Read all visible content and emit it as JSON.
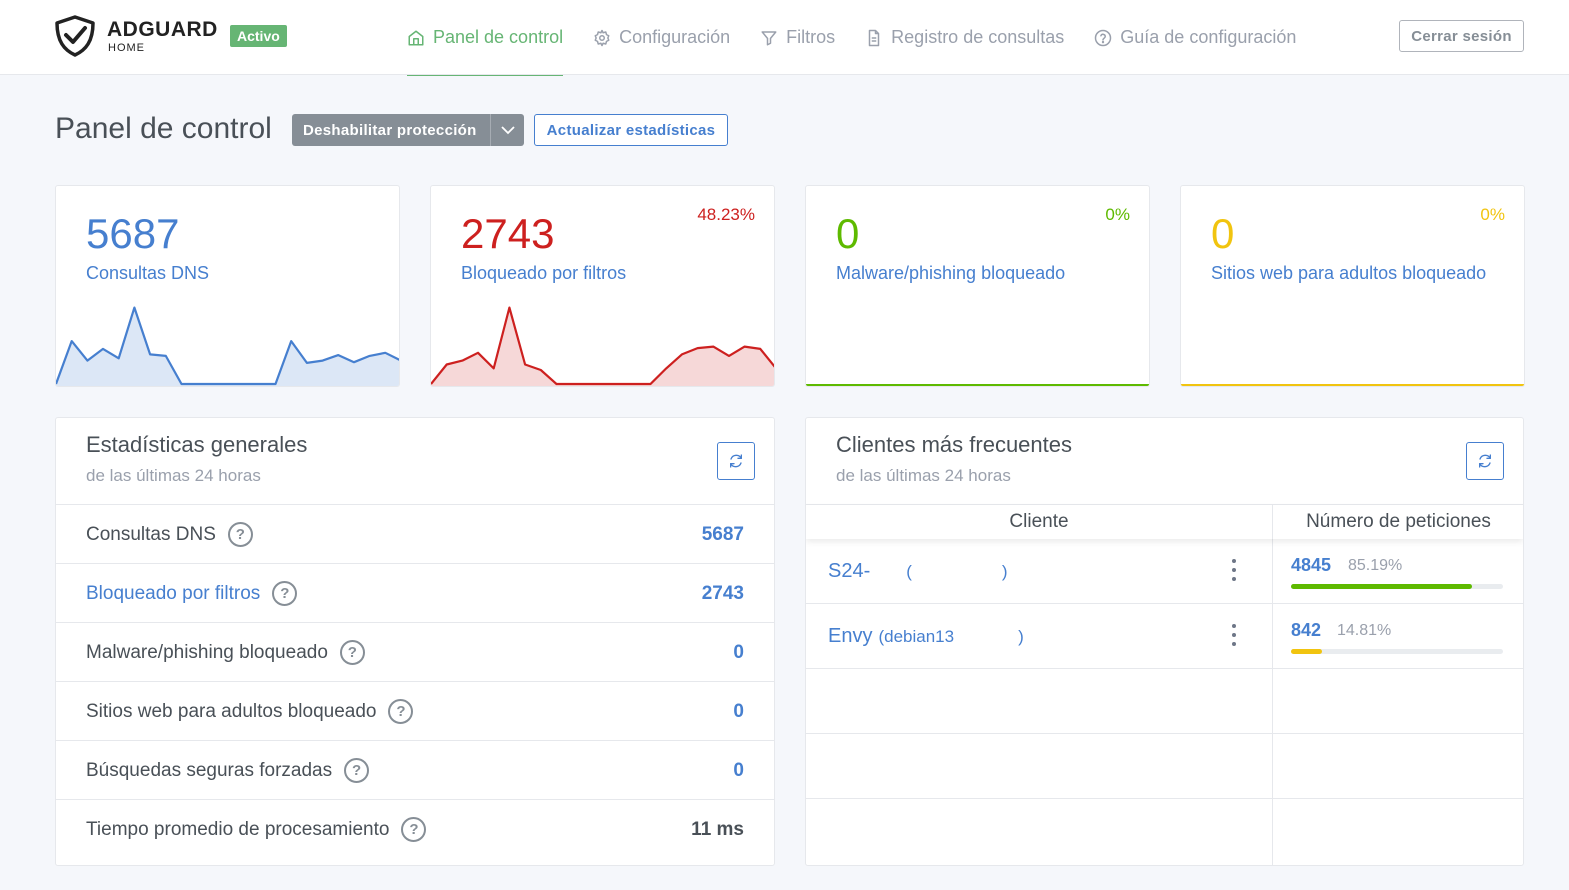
{
  "header": {
    "brand": "ADGUARD",
    "brand_sub": "HOME",
    "status_badge": "Activo",
    "nav": [
      {
        "label": "Panel de control",
        "icon": "home-icon",
        "active": true
      },
      {
        "label": "Configuración",
        "icon": "gear-icon",
        "active": false
      },
      {
        "label": "Filtros",
        "icon": "filter-icon",
        "active": false
      },
      {
        "label": "Registro de consultas",
        "icon": "document-icon",
        "active": false
      },
      {
        "label": "Guía de configuración",
        "icon": "help-circle-icon",
        "active": false
      }
    ],
    "logout_label": "Cerrar sesión"
  },
  "page": {
    "title": "Panel de control",
    "disable_label": "Deshabilitar protección",
    "refresh_label": "Actualizar estadísticas"
  },
  "colors": {
    "blue": "#467fcf",
    "red": "#cd201f",
    "green": "#5eba00",
    "yellow": "#f1c40f",
    "accent_green": "#66b574"
  },
  "stat_cards": [
    {
      "value": "5687",
      "label": "Consultas DNS",
      "percent": "",
      "color": "#467fcf",
      "fill": "#dce7f6",
      "spark": [
        0,
        55,
        30,
        45,
        33,
        98,
        38,
        36,
        0,
        0,
        0,
        0,
        0,
        0,
        0,
        55,
        27,
        30,
        37,
        28,
        36,
        40,
        30
      ]
    },
    {
      "value": "2743",
      "label": "Bloqueado por filtros",
      "percent": "48.23%",
      "color": "#cd201f",
      "fill": "#f6d8d8",
      "spark": [
        0,
        25,
        30,
        40,
        20,
        98,
        25,
        18,
        0,
        0,
        0,
        0,
        0,
        0,
        0,
        20,
        38,
        46,
        48,
        36,
        48,
        45,
        20
      ]
    },
    {
      "value": "0",
      "label": "Malware/phishing bloqueado",
      "percent": "0%",
      "color": "#5eba00",
      "fill": "",
      "spark": []
    },
    {
      "value": "0",
      "label": "Sitios web para adultos bloqueado",
      "percent": "0%",
      "color": "#f1c40f",
      "fill": "",
      "spark": []
    }
  ],
  "general_stats": {
    "title": "Estadísticas generales",
    "subtitle": "de las últimas 24 horas",
    "rows": [
      {
        "label": "Consultas DNS",
        "value": "5687",
        "link": false,
        "dark": false
      },
      {
        "label": "Bloqueado por filtros",
        "value": "2743",
        "link": true,
        "dark": false
      },
      {
        "label": "Malware/phishing bloqueado",
        "value": "0",
        "link": false,
        "dark": false
      },
      {
        "label": "Sitios web para adultos bloqueado",
        "value": "0",
        "link": false,
        "dark": false
      },
      {
        "label": "Búsquedas seguras forzadas",
        "value": "0",
        "link": false,
        "dark": false
      },
      {
        "label": "Tiempo promedio de procesamiento",
        "value": "11 ms",
        "link": false,
        "dark": true
      }
    ]
  },
  "top_clients": {
    "title": "Clientes más frecuentes",
    "subtitle": "de las últimas 24 horas",
    "col_client": "Cliente",
    "col_count": "Número de peticiones",
    "rows": [
      {
        "name": "S24-",
        "ip_open": "(",
        "ip_close": ")",
        "count": "4845",
        "percent": "85.19%",
        "fraction": 0.8519,
        "color": "#5eba00"
      },
      {
        "name": "Envy",
        "ip_open": "(debian13",
        "ip_close": ")",
        "count": "842",
        "percent": "14.81%",
        "fraction": 0.1481,
        "color": "#f1c40f"
      }
    ]
  }
}
